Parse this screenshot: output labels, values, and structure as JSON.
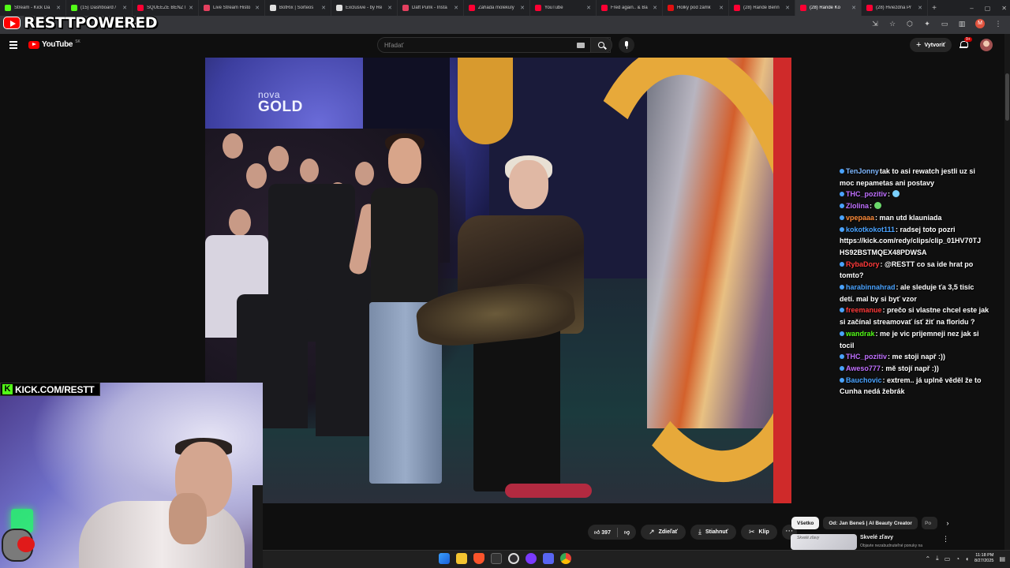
{
  "browser": {
    "tabs": [
      {
        "label": "Stream - Kick Da",
        "color": "#53fc18",
        "active": false
      },
      {
        "label": "(15) Dashboard /",
        "color": "#53fc18",
        "active": false
      },
      {
        "label": "SQUEEZE BENZ D",
        "color": "#ff0033",
        "active": false
      },
      {
        "label": "Live Stream Histo",
        "color": "#e4405f",
        "active": false
      },
      {
        "label": "BotRix | Sorteos",
        "color": "#e0e0e0",
        "active": false
      },
      {
        "label": "Exclusive - by Re",
        "color": "#e0e0e0",
        "active": false
      },
      {
        "label": "Daft Punk - Insta",
        "color": "#e4405f",
        "active": false
      },
      {
        "label": "Záhada molekuly",
        "color": "#ff0033",
        "active": false
      },
      {
        "label": "YouTube",
        "color": "#ff0033",
        "active": false
      },
      {
        "label": "Fred again.. & Ba",
        "color": "#ff0033",
        "active": false
      },
      {
        "label": "Holky pod zámk",
        "color": "#e01010",
        "active": false
      },
      {
        "label": "(28) Rande Benn",
        "color": "#ff0033",
        "active": false
      },
      {
        "label": "(28) Rande Ko",
        "color": "#ff0033",
        "active": true
      },
      {
        "label": "(28) Hviezdna Pr",
        "color": "#ff0033",
        "active": false
      }
    ],
    "new_tab": "+",
    "window_controls": [
      "–",
      "▢",
      "✕"
    ],
    "url_fragment": "E-_6u4"
  },
  "overlay": {
    "streamer_logo": "RESTTPOWERED",
    "kick_link": "KICK.COM/RESTT",
    "kick_icon": "K"
  },
  "youtube": {
    "logo_text": "YouTube",
    "region": "SK",
    "search_placeholder": "Hľadať",
    "create_label": "Vytvoriť",
    "notifications_badge": "9+",
    "like_count": "397",
    "share_label": "Zdieľať",
    "download_label": "Stiahnuť",
    "clip_label": "Klip",
    "more": "⋯",
    "video_watermark": {
      "top": "nova",
      "bottom": "GOLD"
    }
  },
  "chat": [
    {
      "user": "TenJonny",
      "color": "#7fb8ff",
      "msg": "tak to asi rewatch jestli uz si",
      "emote": false
    },
    {
      "user": "",
      "color": "#ffffff",
      "msg": "moc nepametas ani postavy",
      "emote": false
    },
    {
      "user": "THC_pozitiv",
      "color": "#c070ff",
      "msg": ":",
      "emote": true,
      "emote_color": "#7ad0ff"
    },
    {
      "user": "Zlolina",
      "color": "#c070ff",
      "msg": ":",
      "emote": true,
      "emote_color": "#6bd86b"
    },
    {
      "user": "vpepaaa",
      "color": "#ff8c3a",
      "msg": ": man utd klauniada",
      "emote": false
    },
    {
      "user": "kokotkokot111",
      "color": "#4aa3ff",
      "msg": ": radsej toto pozri",
      "emote": false
    },
    {
      "user": "",
      "color": "#ffffff",
      "msg": "https://kick.com/redy/clips/clip_01HV70TJ",
      "emote": false
    },
    {
      "user": "",
      "color": "#ffffff",
      "msg": "HS92BSTMQEX48PDWSA",
      "emote": false
    },
    {
      "user": "RybaDory",
      "color": "#ff3a3a",
      "msg": ": @RESTT co sa ide hrat po",
      "emote": false
    },
    {
      "user": "",
      "color": "#ffffff",
      "msg": "tomto?",
      "emote": false
    },
    {
      "user": "harabinnahrad",
      "color": "#4aa3ff",
      "msg": ": ale sleduje ťa 3,5 tisíc",
      "emote": false
    },
    {
      "user": "",
      "color": "#ffffff",
      "msg": "detí. mal by si byť vzor",
      "emote": false
    },
    {
      "user": "freemanue",
      "color": "#ff3a3a",
      "msg": ": prečo si vlastne chcel este jak",
      "emote": false
    },
    {
      "user": "",
      "color": "#ffffff",
      "msg": "si začínal streamovať ísť žiť na floridu ?",
      "emote": false
    },
    {
      "user": "wandrak",
      "color": "#53fc18",
      "msg": ": me je vic prijemneji nez jak si",
      "emote": false
    },
    {
      "user": "",
      "color": "#ffffff",
      "msg": "tocil",
      "emote": false
    },
    {
      "user": "THC_pozitiv",
      "color": "#c070ff",
      "msg": ": me stoji např :))",
      "emote": false
    },
    {
      "user": "Aweso777",
      "color": "#c070ff",
      "msg": ": mě stojí např :))",
      "emote": false
    },
    {
      "user": "Bauchovic",
      "color": "#4aa3ff",
      "msg": ": extrem.. já uplně věděl že to",
      "emote": false
    },
    {
      "user": "",
      "color": "#ffffff",
      "msg": "Cunha nedá žebrák",
      "emote": false
    }
  ],
  "sidebar": {
    "chips": [
      {
        "label": "Všetko",
        "active": true
      },
      {
        "label": "Od: Jan Beneš | AI Beauty Creator",
        "active": false
      },
      {
        "label": "Po",
        "active": false
      }
    ],
    "next_chip": "›",
    "recommended": {
      "thumb_text": "Skvelé zľavy",
      "title": "Skvelé zľavy",
      "subtitle": "Objavte nezabudnuteľné ponuky na"
    }
  },
  "taskbar": {
    "time": "11:18 PM",
    "date": "8/27/2025"
  }
}
